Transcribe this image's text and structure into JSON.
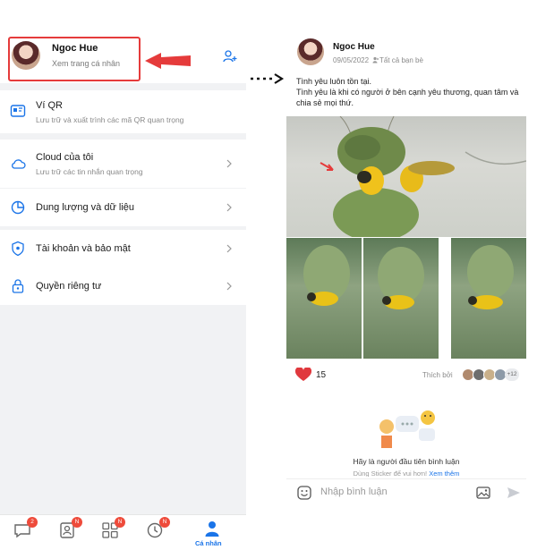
{
  "left": {
    "profile": {
      "name": "Ngoc Hue",
      "subtitle": "Xem trang cá nhân"
    },
    "menu": [
      {
        "title": "Ví QR",
        "subtitle": "Lưu trữ và xuất trình các mã QR quan trọng",
        "icon": "qr-wallet-icon"
      },
      {
        "title": "Cloud của tôi",
        "subtitle": "Lưu trữ các tin nhắn quan trọng",
        "icon": "cloud-icon"
      },
      {
        "title": "Dung lượng và dữ liệu",
        "subtitle": "",
        "icon": "pie-chart-icon"
      },
      {
        "title": "Tài khoản và bảo mật",
        "subtitle": "",
        "icon": "shield-icon"
      },
      {
        "title": "Quyền riêng tư",
        "subtitle": "",
        "icon": "lock-icon"
      }
    ],
    "bottom_nav": {
      "badges": [
        "2",
        "N",
        "N",
        "N"
      ],
      "active_label": "Cá nhân"
    }
  },
  "right": {
    "post": {
      "author": "Ngoc Hue",
      "date": "09/05/2022",
      "audience": "Tất cả bạn bè",
      "line1": "Tình yêu luôn tồn tại.",
      "line2": "Tình yêu là khi có người ở bên cạnh yêu thương, quan tâm và chia sẻ mọi thứ.",
      "like_count": "15",
      "liked_by_label": "Thích bởi",
      "more_likers": "+12"
    },
    "comments": {
      "empty_text": "Hãy là người đầu tiên bình luận",
      "sticker_hint": "Dùng Sticker để vui hơn!",
      "sticker_link": "Xem thêm",
      "input_placeholder": "Nhập bình luận"
    }
  },
  "colors": {
    "accent": "#1a74e8",
    "annotation": "#e53b3b",
    "heart": "#e0393e"
  }
}
